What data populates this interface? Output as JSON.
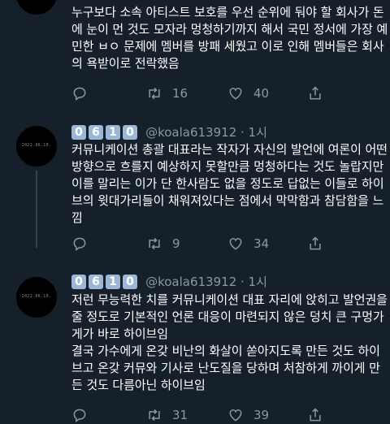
{
  "tweet0": {
    "text": "누구보다 소속 아티스트 보호를 우선 순위에 둬야 할 회사가 돈에 눈이 먼 것도 모자라 멍청하기까지 해서 국민 정서에 가장 예민한 ㅂㅇ 문제에 멤버를 방패 세웠고 이로 인해 멤버들은 회사의 욕받이로 전락했음",
    "retweets": "16",
    "likes": "40"
  },
  "tweet1": {
    "badges": [
      "0",
      "6",
      "1",
      "0"
    ],
    "handle": "@koala613912 · 1시",
    "avatar_text": "2022.06.10.",
    "text": "커뮤니케이션 총괄 대표라는 작자가 자신의 발언에 여론이 어떤 방향으로 흐를지 예상하지 못할만큼 멍청하다는 것도 놀랍지만 이를 말리는 이가 단 한사람도 없을 정도로 답없는 이들로 하이브의 윗대가리들이 채워져있다는 점에서 막막함과 참담함을 느낌",
    "retweets": "9",
    "likes": "34"
  },
  "tweet2": {
    "badges": [
      "0",
      "6",
      "1",
      "0"
    ],
    "handle": "@koala613912 · 1시",
    "avatar_text": "2022.06.10.",
    "text": "저런 무능력한 치를 커뮤니케이션 대표 자리에 앉히고 발언권을 줄 정도로 기본적인 언론 대응이 마련되지 않은 덩치 큰 구멍가게가 바로 하이브임\n결국 가수에게 온갖 비난의 화살이 쏟아지도록 만든 것도 하이브고 온갖 커뮤와 기사로 난도질을 당하며 처참하게 까이게 만든 것도 다름아닌 하이브임",
    "retweets": "31",
    "likes": "39"
  },
  "icons": [
    "reply-icon",
    "retweet-icon",
    "like-icon",
    "share-icon"
  ],
  "colors": {
    "background": "#15202b",
    "secondary_text": "#8899a6",
    "badge": "#9cb7d6",
    "thread_line": "#38444d"
  }
}
